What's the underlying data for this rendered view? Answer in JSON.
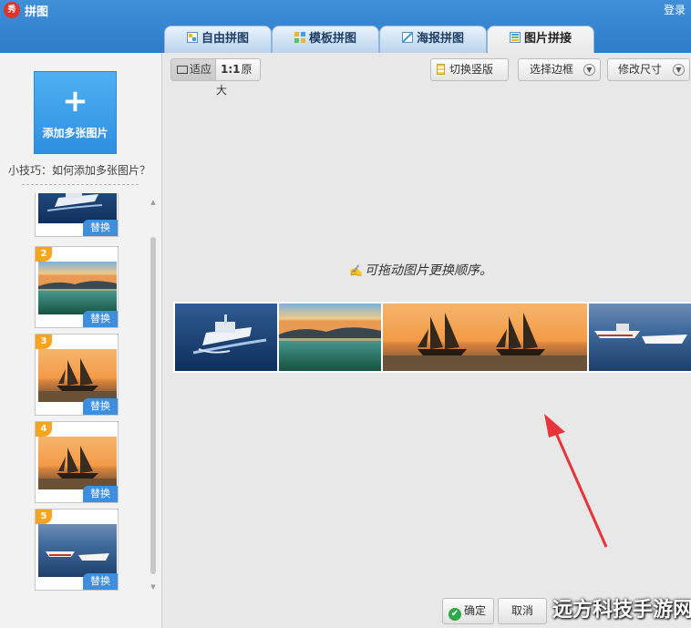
{
  "app": {
    "title": "拼图",
    "logo_text": "秀",
    "login_label": "登录"
  },
  "tabs": [
    {
      "label": "自由拼图",
      "active": false
    },
    {
      "label": "模板拼图",
      "active": false
    },
    {
      "label": "海报拼图",
      "active": false
    },
    {
      "label": "图片拼接",
      "active": true
    }
  ],
  "sidebar": {
    "add_plus": "+",
    "add_label": "添加多张图片",
    "tip": "小技巧：如何添加多张图片？",
    "thumbnails": [
      {
        "number": "",
        "scene": "boat",
        "replace_label": "替换"
      },
      {
        "number": "2",
        "scene": "lake",
        "replace_label": "替换"
      },
      {
        "number": "3",
        "scene": "sailship",
        "replace_label": "替换"
      },
      {
        "number": "4",
        "scene": "sailship",
        "replace_label": "替换"
      },
      {
        "number": "5",
        "scene": "boats",
        "replace_label": "替换"
      }
    ]
  },
  "toolbar": {
    "fit_label": "适应",
    "orig_prefix": "1:1",
    "orig_label": "原大",
    "switch_label": "切换竖版",
    "border_label": "选择边框",
    "size_label": "修改尺寸"
  },
  "canvas": {
    "hint_mark": "✍",
    "hint": "可拖动图片更换顺序。",
    "strip_scenes": [
      "boat",
      "lake",
      "sailship",
      "sailship",
      "boats"
    ]
  },
  "footer": {
    "ok_label": "确定",
    "cancel_label": "取消"
  },
  "watermark": "远方科技手游网",
  "colors": {
    "accent_blue": "#3e8ee0",
    "badge_orange": "#f7a51f",
    "arrow_red": "#e8333a",
    "ok_green": "#2fa84a"
  }
}
